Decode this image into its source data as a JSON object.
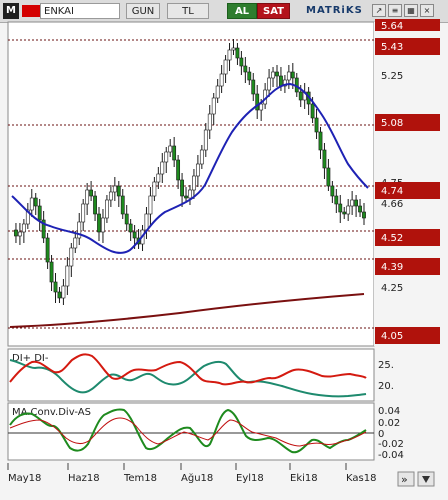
{
  "toolbar": {
    "logo": "M",
    "symbol": "ENKAI",
    "period": "GUN",
    "currency": "TL",
    "buy": "AL",
    "sell": "SAT",
    "brand": "MATRiKS"
  },
  "colors": {
    "candle_up": "#ffffff",
    "candle_down": "#1e8a1e",
    "ma_fast": "#1e22b4",
    "ma_slow": "#7a1010",
    "level_box": "#b0120c",
    "di_plus": "#1e8a6e",
    "di_minus": "#d41a10",
    "macd": "#1e8a1e",
    "signal": "#c01010"
  },
  "price_axis": {
    "ticks": [
      "5.25",
      "4.75",
      "4.66",
      "4.25"
    ],
    "levels": [
      "5.64",
      "5.43",
      "5.08",
      "4.74",
      "4.52",
      "4.39",
      "4.05"
    ]
  },
  "dmi": {
    "label": "DI+ DI-",
    "ticks": [
      "25.",
      "20."
    ]
  },
  "macd": {
    "label": "MA.Conv.Div-AS",
    "ticks": [
      "0.04",
      "0.02",
      "0",
      "-0.02",
      "-0.04"
    ]
  },
  "x_axis": {
    "labels": [
      "May18",
      "Haz18",
      "Tem18",
      "Ağu18",
      "Eyl18",
      "Eki18",
      "Kas18"
    ]
  },
  "footer": {
    "scroll_right": "»"
  }
}
